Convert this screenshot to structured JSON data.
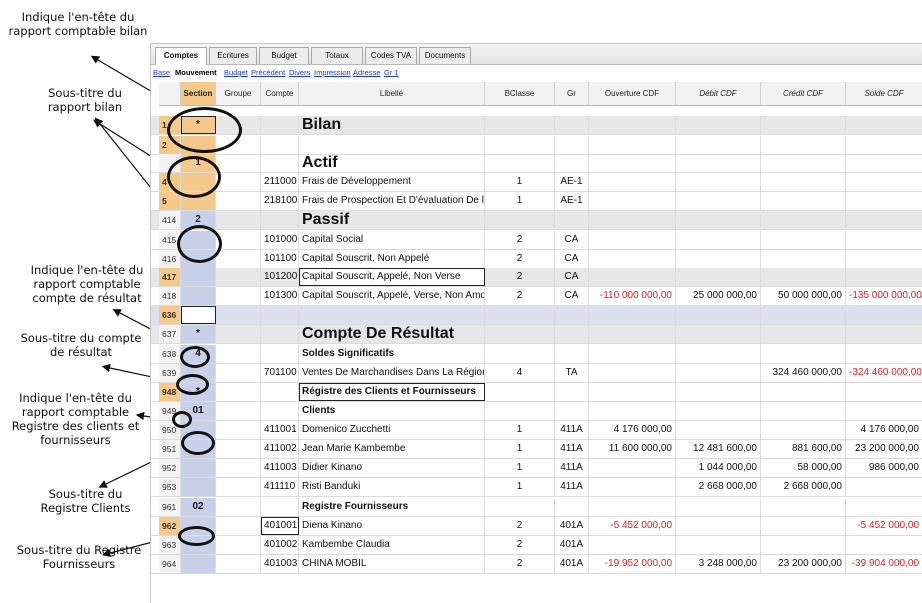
{
  "annotations": [
    {
      "id": "header-bilan",
      "text": "Indique l'en-tête du rapport comptable bilan"
    },
    {
      "id": "subtitle-bilan",
      "text": "Sous-titre du rapport bilan"
    },
    {
      "id": "header-result",
      "text": "Indique l'en-tête du rapport comptable compte de résultat"
    },
    {
      "id": "subtitle-result",
      "text": "Sous-titre du compte de résultat"
    },
    {
      "id": "header-register",
      "text": "Indique l'en-tête du rapport comptable Registre des clients et fournisseurs"
    },
    {
      "id": "subtitle-clients",
      "text": "Sous-titre du Registre Clients"
    },
    {
      "id": "subtitle-suppliers",
      "text": "Sous-titre du Registre Fournisseurs"
    }
  ],
  "tabs": [
    "Comptes",
    "Ecritures",
    "Budget",
    "Totaux",
    "Codes TVA",
    "Documents"
  ],
  "active_tab": "Comptes",
  "views": [
    "Base",
    "Mouvement",
    "Budget",
    "Précédent",
    "Divers",
    "Impression",
    "Adresse",
    "Gr 1"
  ],
  "active_view": "Mouvement",
  "columns": [
    "Section",
    "Groupe",
    "Compte",
    "Libellé",
    "BClasse",
    "Gr",
    "Ouverture CDF",
    "Débit CDF",
    "Crédit CDF",
    "Solde CDF"
  ],
  "rows": [
    {
      "n": "1",
      "section": "*",
      "groupe": "",
      "compte": "",
      "libelle": "Bilan",
      "bclasse": "",
      "gr": "",
      "ouverture": "",
      "debit": "",
      "credit": "",
      "solde": ""
    },
    {
      "n": "2",
      "section": "",
      "groupe": "",
      "compte": "",
      "libelle": "",
      "bclasse": "",
      "gr": "",
      "ouverture": "",
      "debit": "",
      "credit": "",
      "solde": ""
    },
    {
      "n": "",
      "section": "1",
      "groupe": "",
      "compte": "",
      "libelle": "Actif",
      "bclasse": "",
      "gr": "",
      "ouverture": "",
      "debit": "",
      "credit": "",
      "solde": ""
    },
    {
      "n": "4",
      "section": "",
      "groupe": "",
      "compte": "211000",
      "libelle": "Frais de Développement",
      "bclasse": "1",
      "gr": "AE-1",
      "ouverture": "",
      "debit": "",
      "credit": "",
      "solde": ""
    },
    {
      "n": "5",
      "section": "",
      "groupe": "",
      "compte": "218100",
      "libelle": "Frais de Prospection Et D'évaluation De l",
      "bclasse": "1",
      "gr": "AE-1",
      "ouverture": "",
      "debit": "",
      "credit": "",
      "solde": ""
    },
    {
      "n": "414",
      "section": "2",
      "groupe": "",
      "compte": "",
      "libelle": "Passif",
      "bclasse": "",
      "gr": "",
      "ouverture": "",
      "debit": "",
      "credit": "",
      "solde": ""
    },
    {
      "n": "415",
      "section": "",
      "groupe": "",
      "compte": "101000",
      "libelle": "Capital Social",
      "bclasse": "2",
      "gr": "CA",
      "ouverture": "",
      "debit": "",
      "credit": "",
      "solde": ""
    },
    {
      "n": "416",
      "section": "",
      "groupe": "",
      "compte": "101100",
      "libelle": "Capital Souscrit, Non Appelé",
      "bclasse": "2",
      "gr": "CA",
      "ouverture": "",
      "debit": "",
      "credit": "",
      "solde": ""
    },
    {
      "n": "417",
      "section": "",
      "groupe": "",
      "compte": "101200",
      "libelle": "Capital Souscrit, Appelé, Non Verse",
      "bclasse": "2",
      "gr": "CA",
      "ouverture": "",
      "debit": "",
      "credit": "",
      "solde": ""
    },
    {
      "n": "418",
      "section": "",
      "groupe": "",
      "compte": "101300",
      "libelle": "Capital Souscrit, Appelé, Verse, Non Amo",
      "bclasse": "2",
      "gr": "CA",
      "ouverture": "-110 000 000,00",
      "debit": "25 000 000,00",
      "credit": "50 000 000,00",
      "solde": "-135 000 000,00"
    },
    {
      "n": "636",
      "section": "",
      "groupe": "",
      "compte": "",
      "libelle": "",
      "bclasse": "",
      "gr": "",
      "ouverture": "",
      "debit": "",
      "credit": "",
      "solde": ""
    },
    {
      "n": "637",
      "section": "*",
      "groupe": "",
      "compte": "",
      "libelle": "Compte De Résultat",
      "bclasse": "",
      "gr": "",
      "ouverture": "",
      "debit": "",
      "credit": "",
      "solde": ""
    },
    {
      "n": "638",
      "section": "4",
      "groupe": "",
      "compte": "",
      "libelle": "Soldes Significatifs",
      "bclasse": "",
      "gr": "",
      "ouverture": "",
      "debit": "",
      "credit": "",
      "solde": ""
    },
    {
      "n": "639",
      "section": "",
      "groupe": "",
      "compte": "701100",
      "libelle": "Ventes De Marchandises Dans La Région",
      "bclasse": "4",
      "gr": "TA",
      "ouverture": "",
      "debit": "",
      "credit": "324 460 000,00",
      "solde": "-324 460 000,00"
    },
    {
      "n": "948",
      "section": "*",
      "groupe": "",
      "compte": "",
      "libelle": "Régistre des Clients et Fournisseurs",
      "bclasse": "",
      "gr": "",
      "ouverture": "",
      "debit": "",
      "credit": "",
      "solde": ""
    },
    {
      "n": "949",
      "section": "01",
      "groupe": "",
      "compte": "",
      "libelle": "Clients",
      "bclasse": "",
      "gr": "",
      "ouverture": "",
      "debit": "",
      "credit": "",
      "solde": ""
    },
    {
      "n": "950",
      "section": "",
      "groupe": "",
      "compte": "411001",
      "libelle": "Domenico Zucchetti",
      "bclasse": "1",
      "gr": "411A",
      "ouverture": "4 176 000,00",
      "debit": "",
      "credit": "",
      "solde": "4 176 000,00"
    },
    {
      "n": "951",
      "section": "",
      "groupe": "",
      "compte": "411002",
      "libelle": "Jean Marie Kambembe",
      "bclasse": "1",
      "gr": "411A",
      "ouverture": "11 600 000,00",
      "debit": "12 481 600,00",
      "credit": "881 600,00",
      "solde": "23 200 000,00"
    },
    {
      "n": "952",
      "section": "",
      "groupe": "",
      "compte": "411003",
      "libelle": "Didier Kinano",
      "bclasse": "1",
      "gr": "411A",
      "ouverture": "",
      "debit": "1 044 000,00",
      "credit": "58 000,00",
      "solde": "986 000,00"
    },
    {
      "n": "953",
      "section": "",
      "groupe": "",
      "compte": "411110",
      "libelle": "Risti Banduki",
      "bclasse": "1",
      "gr": "411A",
      "ouverture": "",
      "debit": "2 668 000,00",
      "credit": "2 668 000,00",
      "solde": ""
    },
    {
      "n": "961",
      "section": "02",
      "groupe": "",
      "compte": "",
      "libelle": "Registre Fournisseurs",
      "bclasse": "",
      "gr": "",
      "ouverture": "",
      "debit": "",
      "credit": "",
      "solde": ""
    },
    {
      "n": "962",
      "section": "",
      "groupe": "",
      "compte": "401001",
      "libelle": "Diena Kinano",
      "bclasse": "2",
      "gr": "401A",
      "ouverture": "-5 452 000,00",
      "debit": "",
      "credit": "",
      "solde": "-5 452 000,00"
    },
    {
      "n": "963",
      "section": "",
      "groupe": "",
      "compte": "401002",
      "libelle": "Kambembe Claudia",
      "bclasse": "2",
      "gr": "401A",
      "ouverture": "",
      "debit": "",
      "credit": "",
      "solde": ""
    },
    {
      "n": "964",
      "section": "",
      "groupe": "",
      "compte": "401003",
      "libelle": "CHINA MOBIL",
      "bclasse": "2",
      "gr": "401A",
      "ouverture": "-19 952 000,00",
      "debit": "3 248 000,00",
      "credit": "23 200 000,00",
      "solde": "-39 904 000,00"
    }
  ]
}
